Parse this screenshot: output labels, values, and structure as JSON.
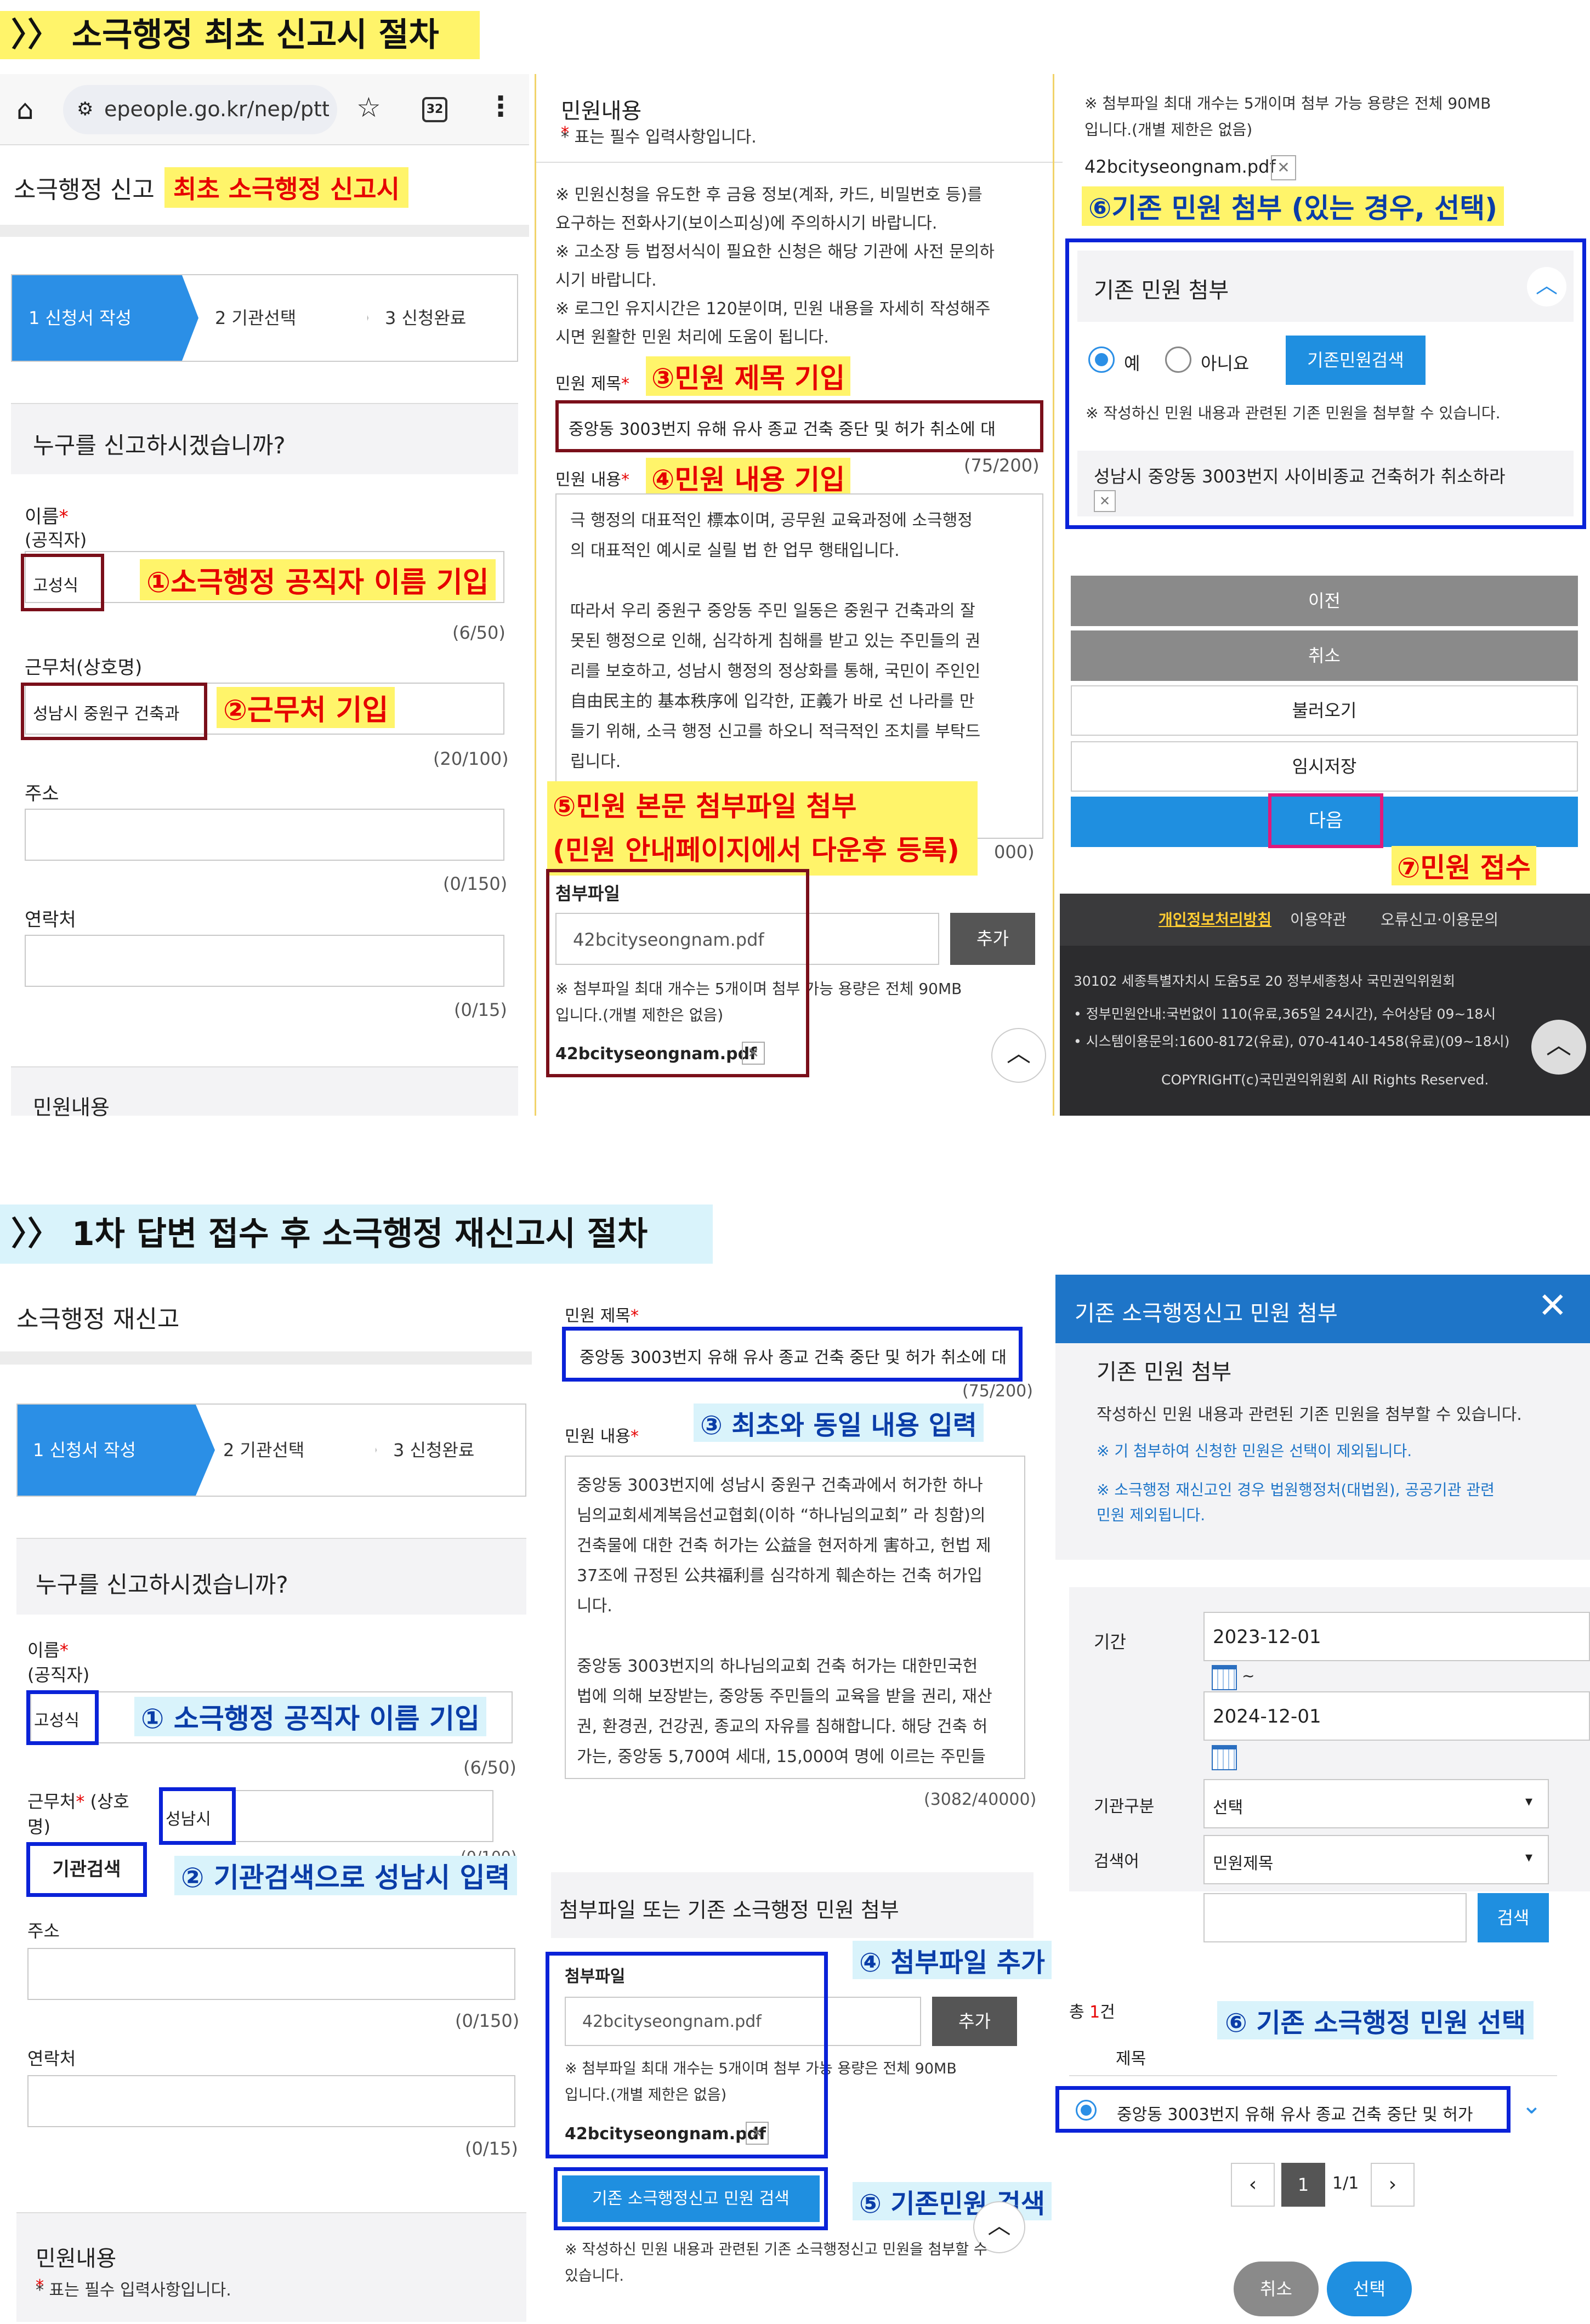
{
  "section1": {
    "title": "〉〉 소극행정 최초 신고시 절차"
  },
  "section2": {
    "title": "〉〉 1차 답변 접수 후 소극행정 재신고시 절차"
  },
  "browser": {
    "url": "epeople.go.kr/nep/pttn/r",
    "tab_count": "32"
  },
  "p1": {
    "page_title": "소극행정 신고",
    "title_annotation": "최초 소극행정 신고시",
    "steps": [
      "1 신청서 작성",
      "2 기관선택",
      "3 신청완료"
    ],
    "who_question": "누구를 신고하시겠습니까?",
    "name_label": "이름",
    "name_sub": "(공직자)",
    "name_value": "고성식",
    "name_annotation": "①소극행정 공직자 이름 기입",
    "name_count": "(6/50)",
    "work_label": "근무처(상호명)",
    "work_value": "성남시 중원구 건축과",
    "work_annotation": "②근무처 기입",
    "work_count": "(20/100)",
    "addr_label": "주소",
    "addr_count": "(0/150)",
    "contact_label": "연락처",
    "contact_count": "(0/15)",
    "section_label": "민원내용"
  },
  "p2": {
    "header": "민원내용",
    "required_note": "* 표는 필수 입력사항입니다.",
    "notices": [
      "※ 민원신청을 유도한 후 금융 정보(계좌, 카드, 비밀번호 등)를",
      "요구하는 전화사기(보이스피싱)에 주의하시기 바랍니다.",
      "※ 고소장 등 법정서식이 필요한 신청은 해당 기관에 사전 문의하",
      "시기 바랍니다.",
      "※ 로그인 유지시간은 120분이며, 민원 내용을 자세히 작성해주",
      "시면 원활한 민원 처리에 도움이 됩니다."
    ],
    "title_label": "민원 제목",
    "title_annotation": "③민원 제목 기입",
    "title_value": "중앙동 3003번지 유해 유사 종교 건축 중단 및 허가 취소에 대",
    "title_count": "(75/200)",
    "content_label": "민원 내용",
    "content_annotation": "④민원 내용 기입",
    "content_lines": [
      "극 행정의 대표적인 標本이며, 공무원 교육과정에 소극행정",
      "의 대표적인 예시로 실릴 법 한 업무 행태입니다.",
      "",
      "  따라서 우리 중원구 중앙동 주민 일동은 중원구 건축과의 잘",
      "못된 행정으로 인해, 심각하게 침해를 받고 있는 주민들의 권",
      "리를 보호하고, 성남시 행정의 정상화를 통해, 국민이 주인인",
      "自由民主的 基本秩序에 입각한, 正義가 바로 선 나라를 만",
      "들기 위해, 소극 행정 신고를 하오니 적극적인 조치를 부탁드",
      "립니다."
    ],
    "content_count": "000)",
    "attach_annotation1": "⑤민원 본문 첨부파일 첨부",
    "attach_annotation2": "(민원 안내페이지에서 다운후 등록)",
    "attach_label": "첨부파일",
    "attach_value": "42bcityseongnam.pdf",
    "add_button": "추가",
    "attach_note1": "※ 첨부파일 최대 개수는 5개이며 첨부 가능 용량은 전체 90MB",
    "attach_note2": "입니다.(개별 제한은 없음)",
    "attached_file": "42bcityseongnam.pdf"
  },
  "p3": {
    "note1": "※ 첨부파일 최대 개수는 5개이며 첨부 가능 용량은 전체 90MB",
    "note2": "입니다.(개별 제한은 없음)",
    "file": "42bcityseongnam.pdf",
    "annotation6": "⑥기존 민원 첨부 (있는 경우, 선택)",
    "box_title": "기존 민원 첨부",
    "radio_yes": "예",
    "radio_no": "아니요",
    "search_button": "기존민원검색",
    "box_note": "※ 작성하신 민원 내용과 관련된 기존 민원을 첨부할 수 있습니다.",
    "linked": "성남시 중앙동 3003번지 사이비종교 건축허가 취소하라",
    "btn_prev": "이전",
    "btn_cancel": "취소",
    "btn_load": "불러오기",
    "btn_temp": "임시저장",
    "btn_next": "다음",
    "annotation7": "⑦민원 접수",
    "footer_links": [
      "개인정보처리방침",
      "이용약관",
      "오류신고·이용문의"
    ],
    "footer_addr": "30102 세종특별자치시 도움5로 20 정부세종청사 국민권익위원회",
    "footer_line1": "정부민원안내:국번없이 110(유료,365일 24시간), 수어상담 09~18시",
    "footer_line2": "시스템이용문의:1600-8172(유료), 070-4140-1458(유료)(09~18시)",
    "footer_copy": "COPYRIGHT(c)국민권익위원회 All Rights Reserved."
  },
  "p4": {
    "page_title": "소극행정 재신고",
    "steps": [
      "1 신청서 작성",
      "2 기관선택",
      "3 신청완료"
    ],
    "who_question": "누구를 신고하시겠습니까?",
    "name_label": "이름",
    "name_sub": "(공직자)",
    "name_value": "고성식",
    "name_annotation": "① 소극행정 공직자 이름 기입",
    "name_count": "(6/50)",
    "work_label1": "근무처",
    "work_label2": " (상호",
    "work_label3": "명)",
    "work_value": "성남시",
    "org_search_button": "기관검색",
    "org_annotation": "② 기관검색으로 성남시 입력",
    "work_count": "(0/100)",
    "addr_label": "주소",
    "addr_count": "(0/150)",
    "contact_label": "연락처",
    "contact_count": "(0/15)",
    "section_label": "민원내용",
    "required_note": "* 표는 필수 입력사항입니다."
  },
  "p5": {
    "title_label": "민원 제목",
    "title_value": "중앙동 3003번지 유해 유사 종교 건축 중단 및 허가 취소에 대",
    "title_count": "(75/200)",
    "content_label": "민원 내용",
    "content_annotation": "③ 최초와 동일 내용 입력",
    "content_lines": [
      "  중앙동 3003번지에 성남시 중원구 건축과에서 허가한 하나",
      "님의교회세계복음선교협회(이하 “하나님의교회” 라 칭함)의",
      "건축물에 대한 건축 허가는 公益을 현저하게 害하고, 헌법 제",
      "37조에 규정된 公共福利를 심각하게 훼손하는 건축 허가입",
      "니다.",
      "",
      "  중앙동 3003번지의 하나님의교회 건축 허가는 대한민국헌",
      "법에 의해 보장받는, 중앙동 주민들의 교육을 받을 권리, 재산",
      "권, 환경권, 건강권, 종교의 자유를 침해합니다. 해당 건축 허",
      "가는, 중앙동 5,700여 세대, 15,000여 명에 이르는 주민들"
    ],
    "content_count": "(3082/40000)",
    "attach_header": "첨부파일 또는 기존 소극행정 민원 첨부",
    "attach_label": "첨부파일",
    "attach_annotation": "④ 첨부파일 추가",
    "attach_value": "42bcityseongnam.pdf",
    "add_button": "추가",
    "attach_note1": "※ 첨부파일 최대 개수는 5개이며 첨부 가능 용량은 전체 90MB",
    "attach_note2": "입니다.(개별 제한은 없음)",
    "attached_file": "42bcityseongnam.pdf",
    "existing_button": "기존 소극행정신고 민원 검색",
    "existing_annotation": "⑤ 기존민원 검색",
    "bottom_note1": "※ 작성하신 민원 내용과 관련된 기존 소극행정신고 민원을 첨부할 수",
    "bottom_note2": "있습니다."
  },
  "p6": {
    "modal_title": "기존 소극행정신고 민원 첨부",
    "section_title": "기존 민원 첨부",
    "desc": "작성하신 민원 내용과 관련된 기존 민원을 첨부할 수 있습니다.",
    "note1": "※ 기 첨부하여 신청한 민원은 선택이 제외됩니다.",
    "note2a": "※ 소극행정 재신고인 경우 법원행정처(대법원), 공공기관 관련",
    "note2b": "민원 제외됩니다.",
    "period_label": "기간",
    "date_from": "2023-12-01",
    "date_sep": "~",
    "date_to": "2024-12-01",
    "org_type_label": "기관구분",
    "org_type_value": "선택",
    "keyword_label": "검색어",
    "keyword_type": "민원제목",
    "search_button": "검색",
    "total_prefix": "총 ",
    "total_count": "1",
    "total_suffix": "건",
    "col_title": "제목",
    "result_item": "중앙동 3003번지 유해 유사 종교 건축 중단 및 허가",
    "annotation6": "⑥ 기존 소극행정 민원 선택",
    "page_current": "1",
    "page_info": "1/1",
    "btn_cancel": "취소",
    "btn_select": "선택"
  },
  "colors": {
    "annotation_red": "#e60000",
    "annotation_blue": "#0a3da8",
    "highlight_yellow": "#fff46a",
    "highlight_blue": "#d9f3fb",
    "primary_blue": "#1f8fe0",
    "dark_box": "#7a0f1a",
    "blue_box": "#0a22d8",
    "magenta": "#e01a7a"
  }
}
